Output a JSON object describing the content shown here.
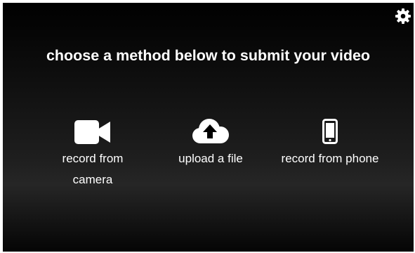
{
  "header": {
    "title": "choose a method below to submit your video",
    "settings_icon": "gear-icon"
  },
  "options": [
    {
      "label": "record from camera",
      "icon": "video-camera-icon"
    },
    {
      "label": "upload a file",
      "icon": "cloud-upload-icon"
    },
    {
      "label": "record from phone",
      "icon": "mobile-phone-icon"
    }
  ],
  "colors": {
    "background": "#000000",
    "text": "#ffffff",
    "icon": "#ffffff"
  }
}
